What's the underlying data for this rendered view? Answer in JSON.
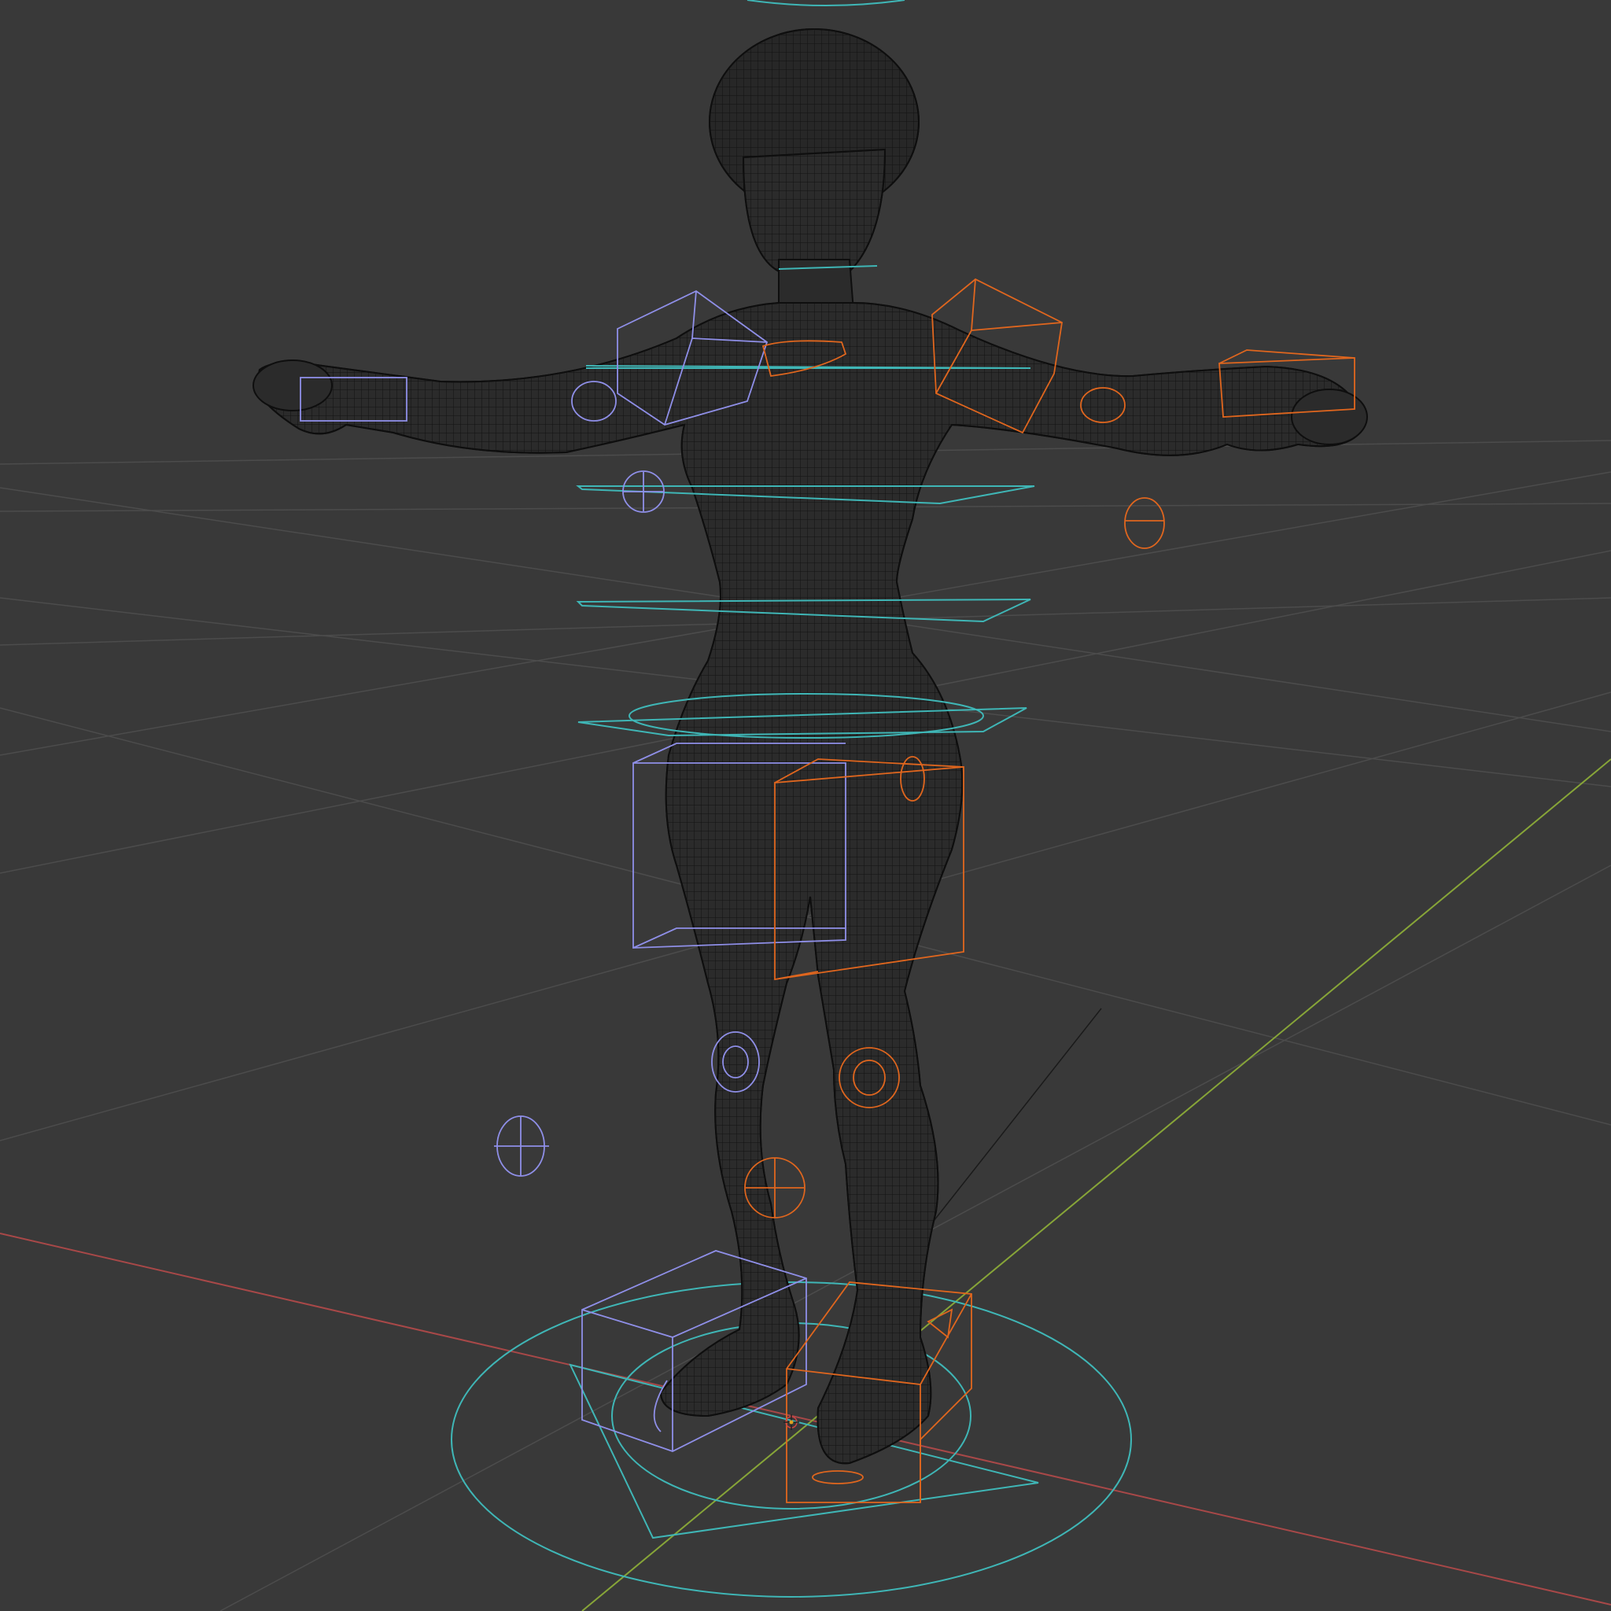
{
  "viewport": {
    "background": "#393939",
    "grid_color": "#4a4a4a",
    "axis_x_color": "#b04646",
    "axis_y_color": "#8aa83a"
  },
  "mesh": {
    "fill": "#2a2a2a",
    "wire_color": "#101010"
  },
  "rig": {
    "left_control_color": "#8f8fe8",
    "right_control_color": "#e0661e",
    "center_control_color": "#3fb6b6"
  },
  "cursor": {
    "icon": "3d-cursor-icon"
  }
}
